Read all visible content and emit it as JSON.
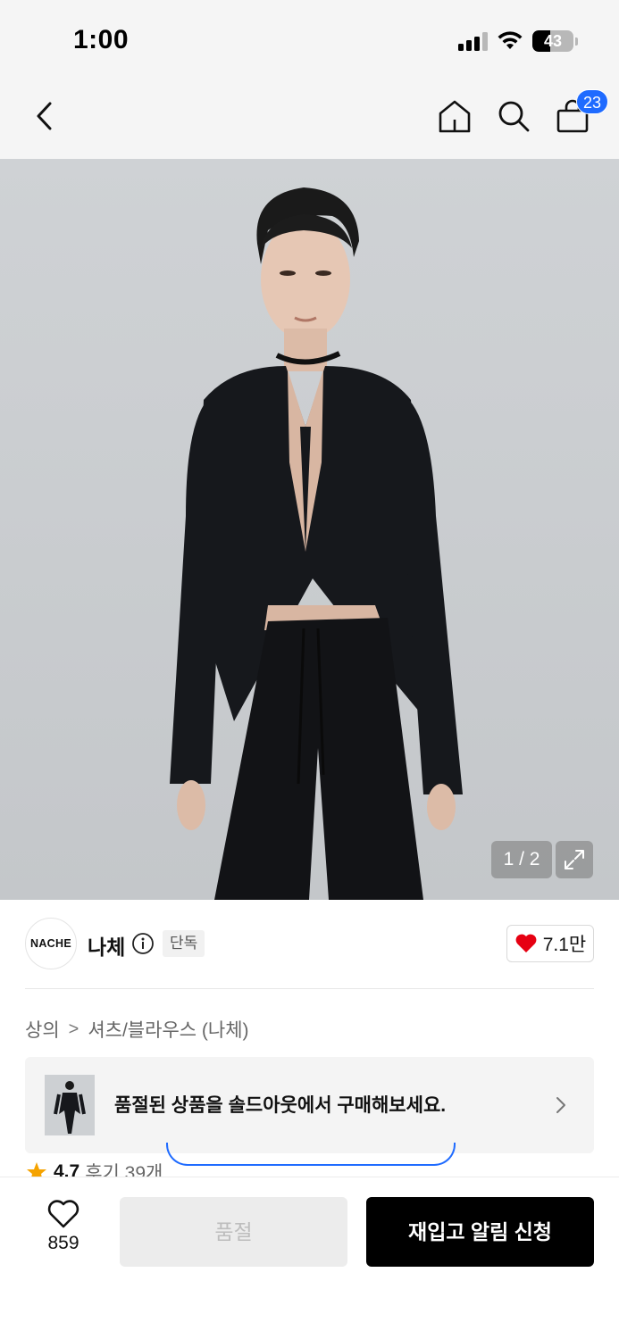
{
  "status_bar": {
    "time": "1:00",
    "battery": "43",
    "battery_level_percent": 43
  },
  "nav": {
    "cart_count": "23",
    "icons": [
      "chevron-left-icon",
      "home-icon",
      "search-icon",
      "shopping-bag-icon"
    ]
  },
  "gallery": {
    "counter": "1 / 2"
  },
  "brand": {
    "logo_text": "NACHE",
    "name": "나체",
    "badge": "단독",
    "likes": "7.1만"
  },
  "breadcrumb": [
    "상의",
    "셔츠/블라우스 (나체)"
  ],
  "soldout_banner": {
    "text": "품절된 상품을 솔드아웃에서 구매해보세요."
  },
  "rating": {
    "score": "4.7",
    "reviews": "후기 39개"
  },
  "bottom_bar": {
    "wish_count": "859",
    "soldout_label": "품절",
    "restock_label": "재입고 알림 신청"
  },
  "colors": {
    "accent_blue": "#1f6bff",
    "heart_red": "#e60012",
    "primary_black": "#000000"
  }
}
